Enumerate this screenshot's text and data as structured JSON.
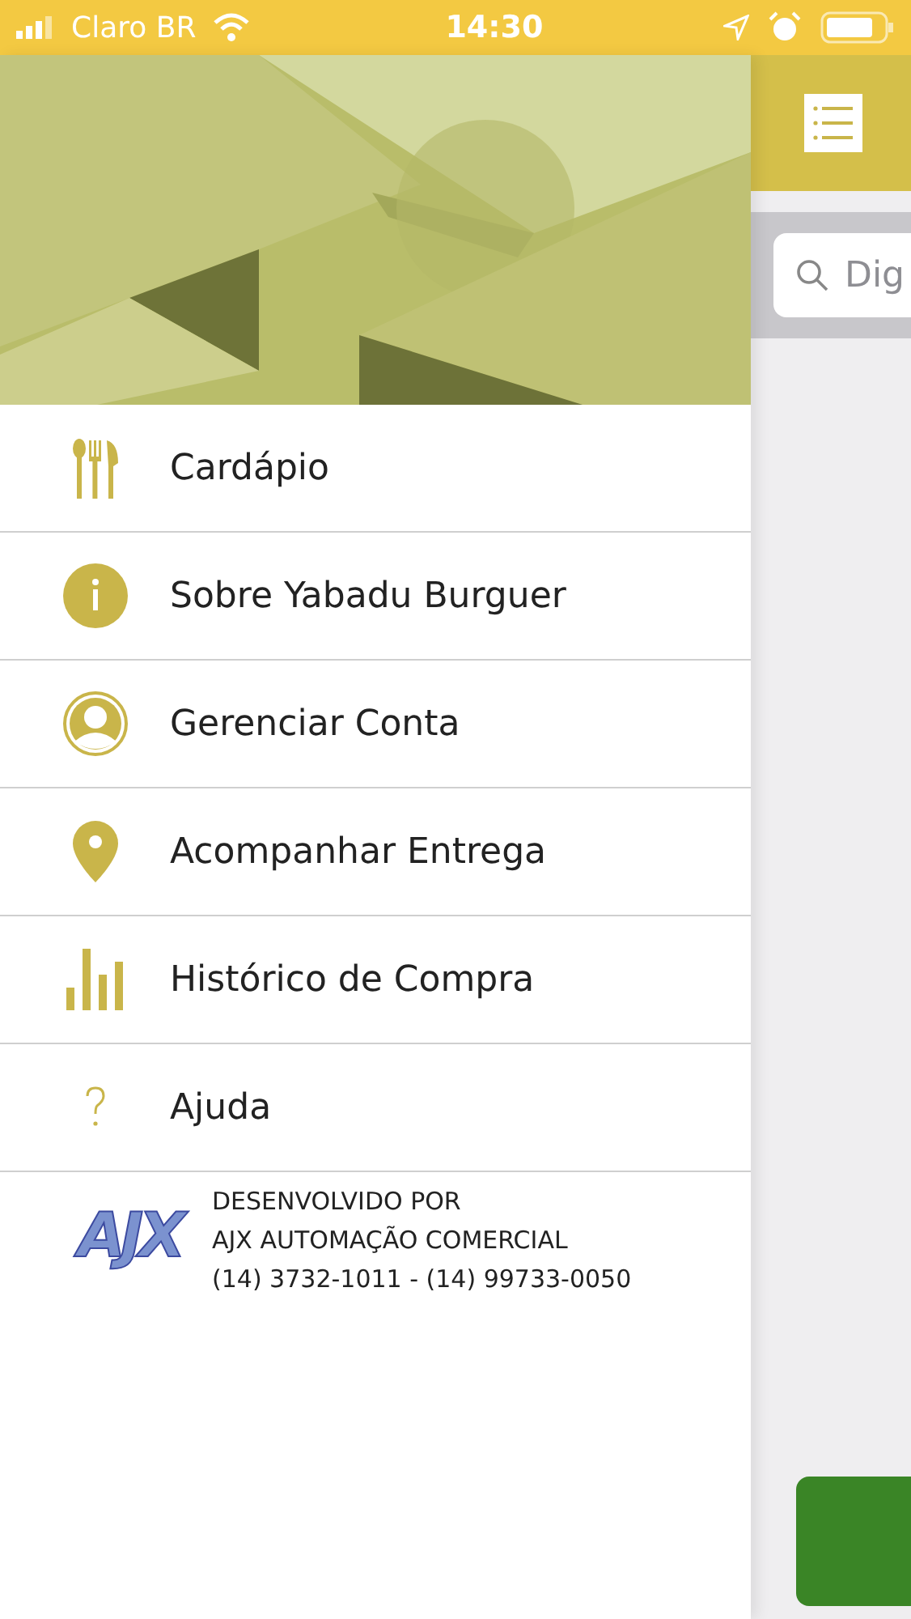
{
  "status_bar": {
    "carrier": "Claro BR",
    "time": "14:30"
  },
  "search": {
    "placeholder": "Dig"
  },
  "menu": [
    {
      "kind": "cutlery",
      "label": "Cardápio"
    },
    {
      "kind": "info",
      "label": "Sobre Yabadu Burguer"
    },
    {
      "kind": "account",
      "label": "Gerenciar Conta"
    },
    {
      "kind": "pin",
      "label": "Acompanhar Entrega"
    },
    {
      "kind": "chart",
      "label": "Histórico de Compra"
    },
    {
      "kind": "help",
      "label": "Ajuda"
    }
  ],
  "footer": {
    "logo": "AJX",
    "lines": [
      "DESENVOLVIDO POR",
      "AJX AUTOMAÇÃO COMERCIAL",
      "(14) 3732-1011 - (14) 99733-0050"
    ]
  }
}
